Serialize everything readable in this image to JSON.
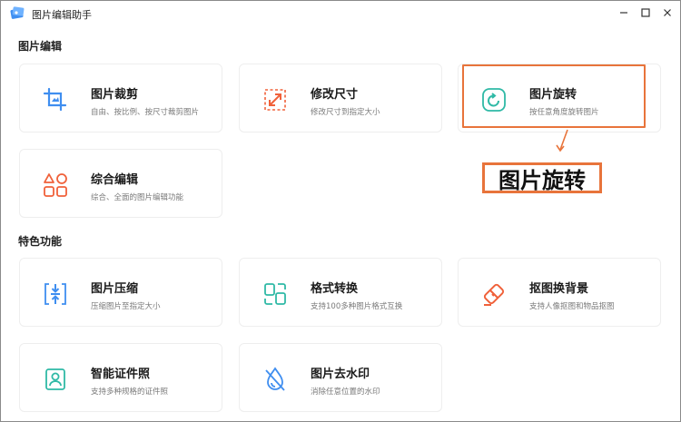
{
  "window": {
    "title": "图片编辑助手"
  },
  "sections": {
    "edit": "图片编辑",
    "features": "特色功能"
  },
  "cards": {
    "crop": {
      "name": "图片裁剪",
      "desc": "自由、按比例、按尺寸裁剪图片"
    },
    "resize": {
      "name": "修改尺寸",
      "desc": "修改尺寸到指定大小"
    },
    "rotate": {
      "name": "图片旋转",
      "desc": "按任意角度旋转图片"
    },
    "combo": {
      "name": "综合编辑",
      "desc": "综合、全面的图片编辑功能"
    },
    "compress": {
      "name": "图片压缩",
      "desc": "压缩图片至指定大小"
    },
    "convert": {
      "name": "格式转换",
      "desc": "支持100多种图片格式互换"
    },
    "cutout": {
      "name": "抠图换背景",
      "desc": "支持人像抠图和物品抠图"
    },
    "idphoto": {
      "name": "智能证件照",
      "desc": "支持多种规格的证件照"
    },
    "watermark": {
      "name": "图片去水印",
      "desc": "消除任意位置的水印"
    }
  },
  "annotation": {
    "label": "图片旋转"
  },
  "colors": {
    "accent_orange": "#e8743b",
    "icon_blue": "#3f8ef0",
    "icon_teal": "#2fb9a6",
    "icon_red": "#f0613a"
  }
}
